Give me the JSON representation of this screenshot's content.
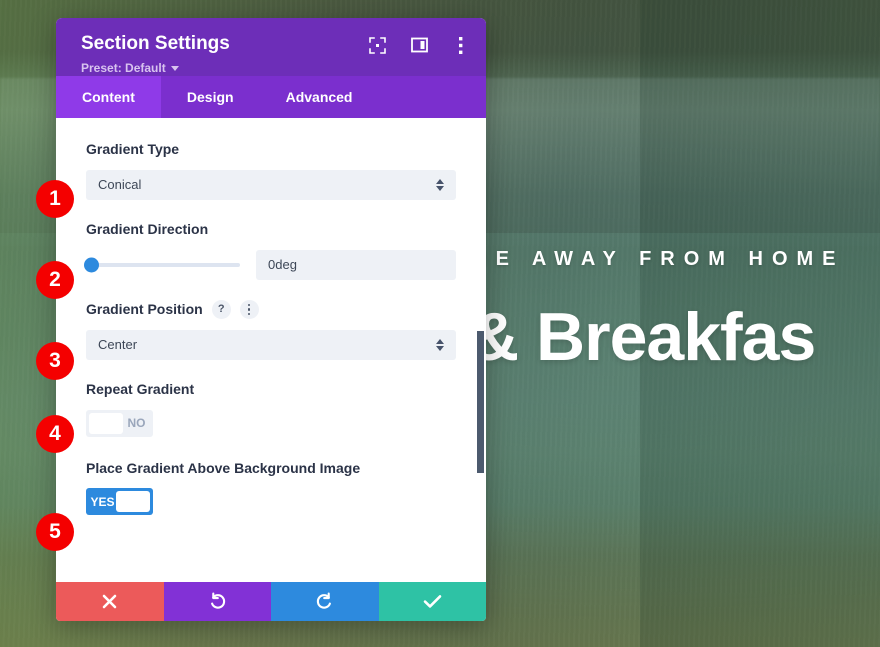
{
  "background": {
    "hero_kicker": "ME AWAY FROM HOME",
    "hero_title": "& Breakfas",
    "overlay_color": "#3c5c46"
  },
  "panel": {
    "title": "Section Settings",
    "preset_label": "Preset: Default",
    "header_icons": [
      {
        "name": "fullscreen-icon",
        "label": "Expand"
      },
      {
        "name": "layout-icon",
        "label": "Layout"
      },
      {
        "name": "more-options-icon",
        "label": "More Options"
      }
    ],
    "tabs": [
      {
        "label": "Content",
        "active": true
      },
      {
        "label": "Design",
        "active": false
      },
      {
        "label": "Advanced",
        "active": false
      }
    ],
    "fields": {
      "gradient_type": {
        "label": "Gradient Type",
        "value": "Conical"
      },
      "gradient_direction": {
        "label": "Gradient Direction",
        "value": "0deg",
        "slider_percent": 0
      },
      "gradient_position": {
        "label": "Gradient Position",
        "help_icon": "?",
        "value": "Center"
      },
      "repeat_gradient": {
        "label": "Repeat Gradient",
        "state": "NO",
        "on": false
      },
      "place_gradient_above": {
        "label": "Place Gradient Above Background Image",
        "state": "YES",
        "on": true
      }
    },
    "footer_buttons": [
      {
        "name": "cancel-button",
        "icon": "close-icon",
        "color": "#ec5a5a"
      },
      {
        "name": "undo-button",
        "icon": "undo-icon",
        "color": "#8231d6"
      },
      {
        "name": "redo-button",
        "icon": "redo-icon",
        "color": "#2d8ade"
      },
      {
        "name": "save-button",
        "icon": "check-icon",
        "color": "#2ec2a5"
      }
    ]
  },
  "badges": [
    {
      "number": "1"
    },
    {
      "number": "2"
    },
    {
      "number": "3"
    },
    {
      "number": "4"
    },
    {
      "number": "5"
    }
  ]
}
